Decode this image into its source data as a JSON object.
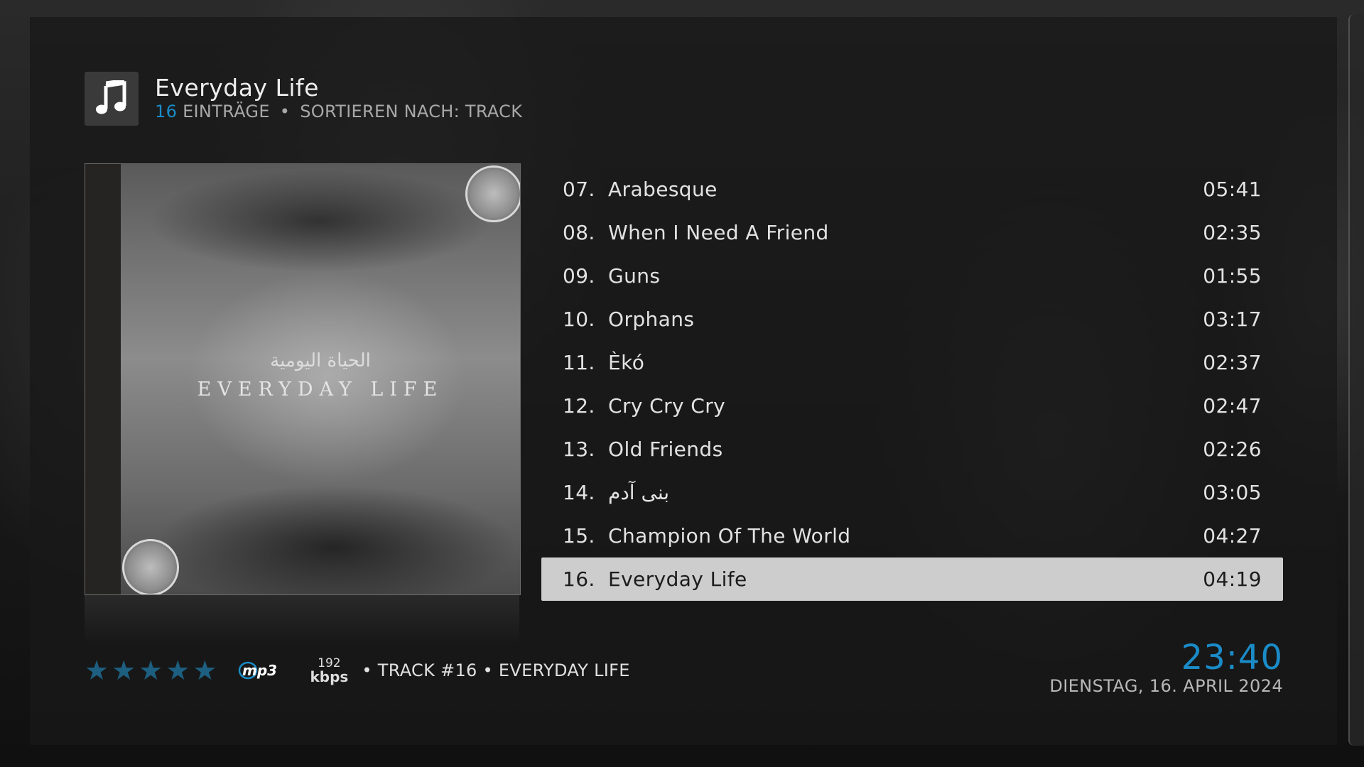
{
  "header": {
    "title": "Everyday Life",
    "count": "16",
    "count_label": "EINTRÄGE",
    "separator": "•",
    "sort_label": "SORTIEREN NACH: TRACK",
    "icon": "music-note-icon"
  },
  "album_art": {
    "arabic_text": "الحياة اليومية",
    "title_text": "EVERYDAY LIFE"
  },
  "tracks": [
    {
      "num": "07.",
      "title": "Arabesque",
      "duration": "05:41"
    },
    {
      "num": "08.",
      "title": "When I Need A Friend",
      "duration": "02:35"
    },
    {
      "num": "09.",
      "title": "Guns",
      "duration": "01:55"
    },
    {
      "num": "10.",
      "title": "Orphans",
      "duration": "03:17"
    },
    {
      "num": "11.",
      "title": "Èkó",
      "duration": "02:37"
    },
    {
      "num": "12.",
      "title": "Cry Cry Cry",
      "duration": "02:47"
    },
    {
      "num": "13.",
      "title": "Old Friends",
      "duration": "02:26"
    },
    {
      "num": "14.",
      "title": "بنی آدم",
      "duration": "03:05"
    },
    {
      "num": "15.",
      "title": "Champion Of The World",
      "duration": "04:27"
    },
    {
      "num": "16.",
      "title": "Everyday Life",
      "duration": "04:19"
    }
  ],
  "selected_index": 9,
  "footer": {
    "rating_stars": 5,
    "codec": "mp3",
    "bitrate_value": "192",
    "bitrate_unit": "kbps",
    "track_info": "• TRACK #16 •  EVERYDAY LIFE"
  },
  "clock": {
    "time": "23:40",
    "date": "DIENSTAG, 16. APRIL 2024"
  },
  "colors": {
    "accent": "#1a8bc7",
    "star": "#1d5f80",
    "selected_row": "#cdcdcd"
  }
}
